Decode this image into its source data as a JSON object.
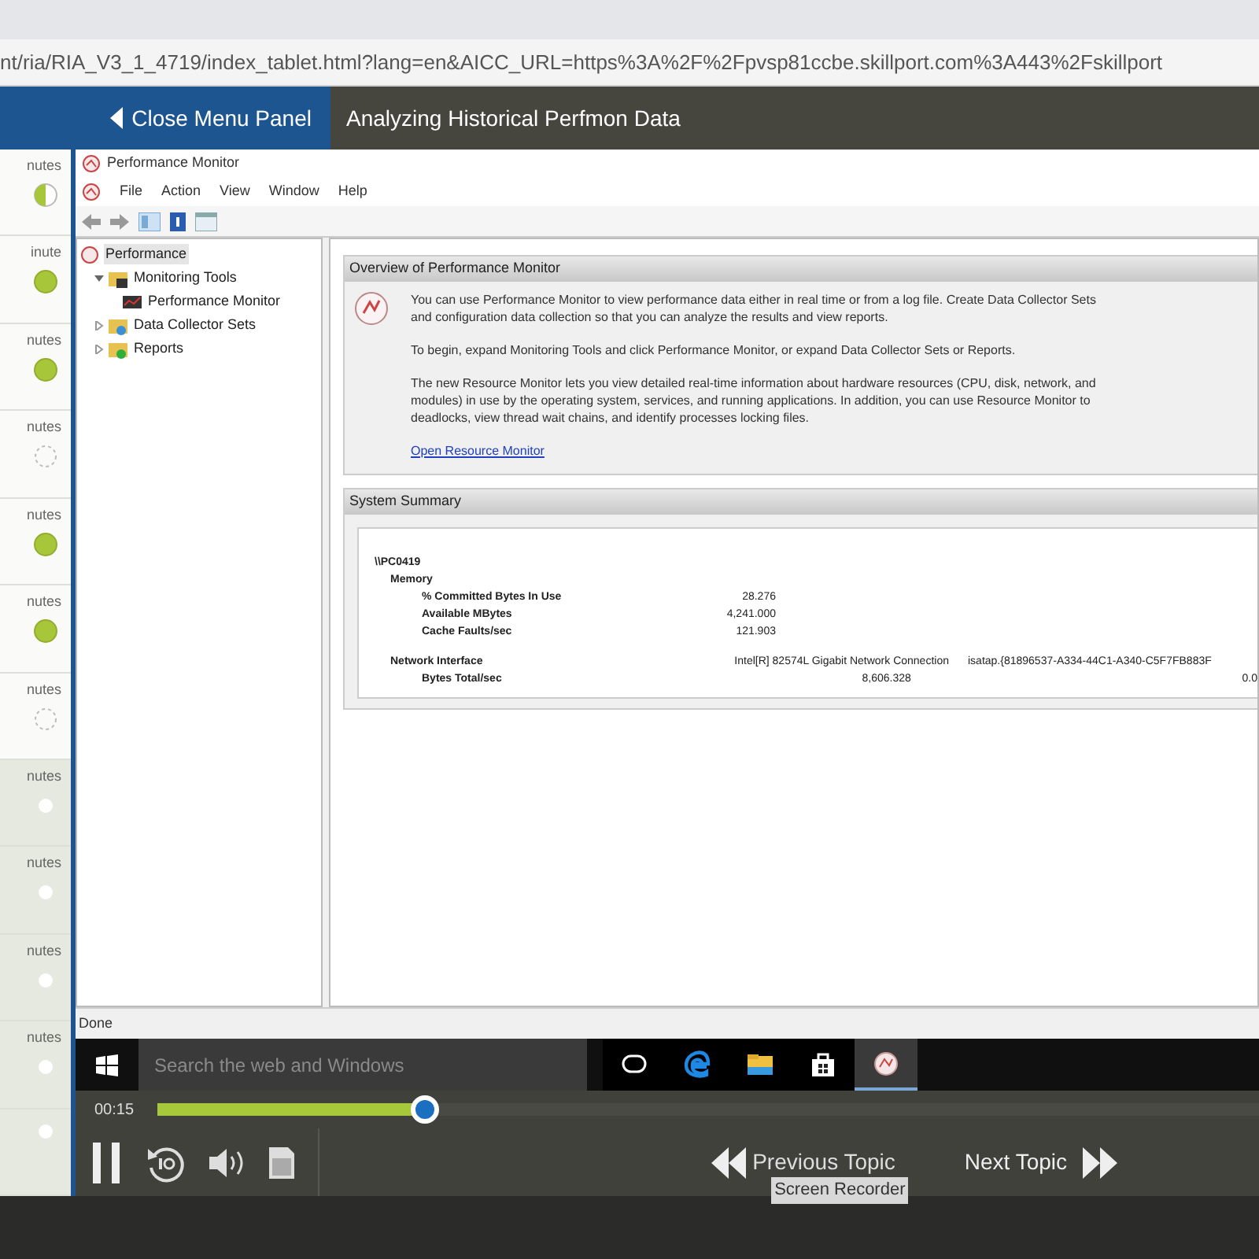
{
  "address_bar": {
    "url": "nt/ria/RIA_V3_1_4719/index_tablet.html?lang=en&AICC_URL=https%3A%2F%2Fpvsp81ccbe.skillport.com%3A443%2Fskillport"
  },
  "header": {
    "menu_button": "Close Menu Panel",
    "title": "Analyzing Historical Perfmon Data"
  },
  "sidebar": {
    "items": [
      {
        "label": "nutes",
        "kind": "partial"
      },
      {
        "label": "inute",
        "kind": "complete"
      },
      {
        "label": "nutes",
        "kind": "complete"
      },
      {
        "label": "nutes",
        "kind": "not_started"
      },
      {
        "label": "nutes",
        "kind": "complete"
      },
      {
        "label": "nutes",
        "kind": "complete"
      },
      {
        "label": "nutes",
        "kind": "not_started"
      },
      {
        "label": "nutes",
        "kind": "locked"
      },
      {
        "label": "nutes",
        "kind": "locked"
      },
      {
        "label": "nutes",
        "kind": "locked"
      },
      {
        "label": "nutes",
        "kind": "locked"
      },
      {
        "kind": "locked"
      }
    ]
  },
  "app_window": {
    "title": "Performance Monitor",
    "menu": [
      "File",
      "Action",
      "View",
      "Window",
      "Help"
    ],
    "tree": [
      {
        "label": "Performance",
        "selected": true,
        "children": [
          {
            "label": "Monitoring Tools",
            "selected": false,
            "expanded": true,
            "children": [
              {
                "label": "Performance Monitor",
                "selected": false
              }
            ]
          },
          {
            "label": "Data Collector Sets",
            "selected": false,
            "expanded": false
          },
          {
            "label": "Reports",
            "selected": false,
            "expanded": false
          }
        ]
      }
    ],
    "overview": {
      "title": "Overview of Performance Monitor",
      "paragraphs": [
        [
          "You can use Performance Monitor to view performance data either in real time or from a log file. Create Data Collector Sets",
          "and configuration data collection so that you can analyze the results and view reports."
        ],
        [
          "To begin, expand Monitoring Tools and click Performance Monitor, or expand Data Collector Sets or Reports."
        ],
        [
          "The new Resource Monitor lets you view detailed real-time information about hardware resources (CPU, disk, network, and",
          "modules) in use by the operating system, services, and running applications. In addition, you can use Resource Monitor to",
          "deadlocks, view thread wait chains, and identify processes locking files."
        ]
      ],
      "link": "Open Resource Monitor"
    },
    "summary": {
      "title": "System Summary",
      "computer": "\\\\PC0419",
      "memory": {
        "label": "Memory",
        "rows": [
          {
            "name": "% Committed Bytes In Use",
            "value": "28.276"
          },
          {
            "name": "Available MBytes",
            "value": "4,241.000"
          },
          {
            "name": "Cache Faults/sec",
            "value": "121.903"
          }
        ]
      },
      "network": {
        "label": "Network Interface",
        "columns": [
          "Intel[R] 82574L Gigabit Network Connection",
          "isatap.{81896537-A334-44C1-A340-C5F7FB883F"
        ],
        "rows": [
          {
            "name": "Bytes Total/sec",
            "values": [
              "8,606.328",
              "0.0"
            ]
          }
        ]
      }
    },
    "status": "Done"
  },
  "taskbar": {
    "search_placeholder": "Search the web and Windows",
    "apps": [
      {
        "kind": "taskview",
        "selected": false
      },
      {
        "kind": "edge",
        "selected": false
      },
      {
        "kind": "folder",
        "selected": false
      },
      {
        "kind": "store",
        "selected": false
      },
      {
        "kind": "perfmon",
        "selected": true
      }
    ]
  },
  "player": {
    "time": "00:15",
    "level": 0.243,
    "previous": "Previous Topic",
    "next": "Next Topic",
    "tooltip": "Screen Recorder"
  }
}
